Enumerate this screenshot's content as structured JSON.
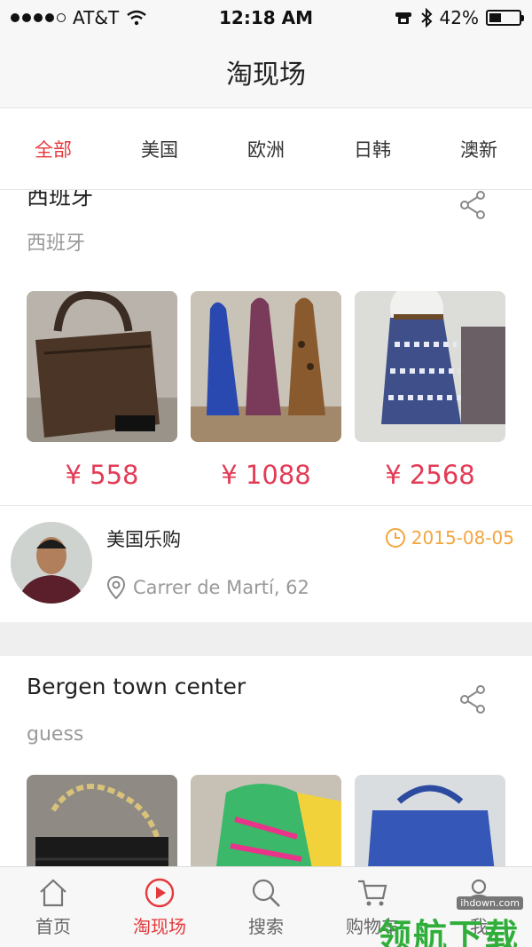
{
  "status_bar": {
    "carrier": "AT&T",
    "time": "12:18 AM",
    "battery": "42%",
    "battery_level": 0.42,
    "icons": [
      "signal-dots-icon",
      "wifi-icon",
      "phone-icon",
      "bluetooth-icon",
      "battery-icon"
    ]
  },
  "header": {
    "title": "淘现场"
  },
  "tabs": [
    {
      "label": "全部",
      "active": true
    },
    {
      "label": "美国",
      "active": false
    },
    {
      "label": "欧洲",
      "active": false
    },
    {
      "label": "日韩",
      "active": false
    },
    {
      "label": "澳新",
      "active": false
    }
  ],
  "posts": [
    {
      "title": "西班牙",
      "subtitle": "西班牙",
      "products": [
        {
          "name": "handbag",
          "price": "¥ 558"
        },
        {
          "name": "high-heels",
          "price": "¥ 1088"
        },
        {
          "name": "skirt",
          "price": "¥ 2568"
        }
      ],
      "seller": {
        "name": "美国乐购",
        "date": "2015-08-05",
        "location": "Carrer de Martí, 62"
      }
    },
    {
      "title": "Bergen town center",
      "subtitle": "guess",
      "products": [
        {
          "name": "quilted-bag"
        },
        {
          "name": "sneakers"
        },
        {
          "name": "blue-bag"
        }
      ]
    }
  ],
  "tab_bar": [
    {
      "label": "首页",
      "icon": "home-icon",
      "active": false
    },
    {
      "label": "淘现场",
      "icon": "play-icon",
      "active": true
    },
    {
      "label": "搜索",
      "icon": "search-icon",
      "active": false
    },
    {
      "label": "购物车",
      "icon": "cart-icon",
      "active": false
    },
    {
      "label": "我",
      "icon": "user-icon",
      "active": false
    }
  ],
  "watermark": {
    "text": "领航下载",
    "url": "ihdown.com"
  },
  "colors": {
    "accent": "#e4393c",
    "price": "#e33b55",
    "date": "#f2a640"
  }
}
